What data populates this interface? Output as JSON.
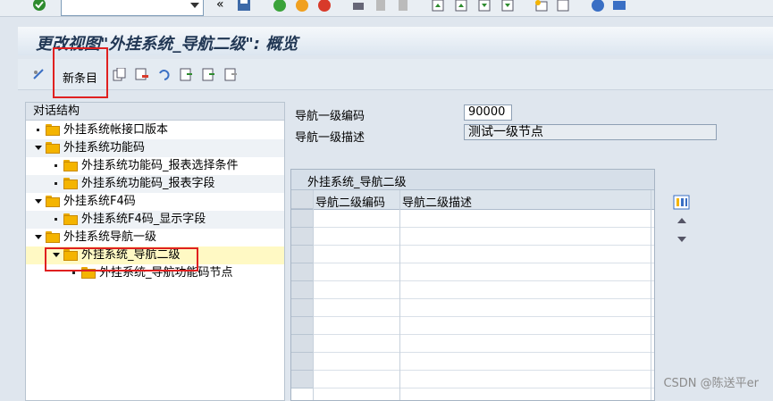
{
  "toolbar": {
    "command_field_value": "",
    "icons": [
      "check-icon",
      "save-icon",
      "back-icon",
      "exit-icon",
      "cancel-icon",
      "print-icon",
      "find-icon",
      "find-next-icon",
      "first-page-icon",
      "prev-page-icon",
      "next-page-icon",
      "last-page-icon",
      "new-session-icon",
      "shortcut-icon",
      "help-icon",
      "layout-icon"
    ]
  },
  "title": "更改视图\"外挂系统_导航二级\": 概览",
  "app_toolbar": {
    "new_entries": "新条目",
    "icons": [
      "display-change-icon",
      "copy-icon",
      "delete-icon",
      "undo-icon",
      "select-all-icon",
      "select-block-icon",
      "deselect-all-icon"
    ]
  },
  "tree": {
    "header": "对话结构",
    "items": [
      {
        "label": "外挂系统帐接口版本",
        "level": 0,
        "type": "leaf"
      },
      {
        "label": "外挂系统功能码",
        "level": 0,
        "type": "expanded"
      },
      {
        "label": "外挂系统功能码_报表选择条件",
        "level": 1,
        "type": "leaf"
      },
      {
        "label": "外挂系统功能码_报表字段",
        "level": 1,
        "type": "leaf"
      },
      {
        "label": "外挂系统F4码",
        "level": 0,
        "type": "expanded"
      },
      {
        "label": "外挂系统F4码_显示字段",
        "level": 1,
        "type": "leaf"
      },
      {
        "label": "外挂系统导航一级",
        "level": 0,
        "type": "expanded"
      },
      {
        "label": "外挂系统_导航二级",
        "level": 1,
        "type": "expanded",
        "selected": true
      },
      {
        "label": "外挂系统_导航功能码节点",
        "level": 2,
        "type": "leaf"
      }
    ]
  },
  "form": {
    "code_label": "导航一级编码",
    "code_value": "90000",
    "desc_label": "导航一级描述",
    "desc_value": "测试一级节点"
  },
  "table": {
    "title": "外挂系统_导航二级",
    "columns": [
      "导航二级编码",
      "导航二级描述"
    ],
    "rows": []
  },
  "watermark": "CSDN @陈送平er",
  "colors": {
    "highlight": "#e02020",
    "selected_row": "#fff9c4",
    "folder": "#f4b400"
  }
}
